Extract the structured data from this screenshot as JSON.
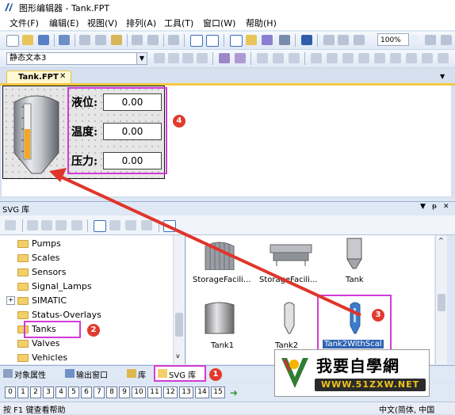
{
  "window": {
    "title": "图形编辑器 - Tank.FPT"
  },
  "menu": [
    "文件(F)",
    "编辑(E)",
    "视图(V)",
    "排列(A)",
    "工具(T)",
    "窗口(W)",
    "帮助(H)"
  ],
  "toolbar": {
    "zoom": "100%",
    "text_style": "静态文本3"
  },
  "document": {
    "tab_label": "Tank.FPT",
    "fields": [
      {
        "label": "液位:",
        "value": "0.00"
      },
      {
        "label": "温度:",
        "value": "0.00"
      },
      {
        "label": "压力:",
        "value": "0.00"
      }
    ]
  },
  "library": {
    "title": "SVG 库",
    "tree": [
      "Pumps",
      "Scales",
      "Sensors",
      "Signal_Lamps",
      "SIMATIC",
      "Status-Overlays",
      "Tanks",
      "Valves",
      "Vehicles"
    ],
    "selected_tree_item": "Tanks",
    "gallery": [
      {
        "caption": "StorageFacili..."
      },
      {
        "caption": "StorageFacili..."
      },
      {
        "caption": "Tank"
      },
      {
        "caption": "Tank1"
      },
      {
        "caption": "Tank2"
      },
      {
        "caption": "Tank2WithScal"
      }
    ]
  },
  "annotations": [
    "1",
    "2",
    "3",
    "4"
  ],
  "bottom_tabs": [
    "对象属性",
    "输出窗口",
    "库",
    "SVG 库"
  ],
  "layers": [
    "0",
    "1",
    "2",
    "3",
    "4",
    "5",
    "6",
    "7",
    "8",
    "9",
    "10",
    "11",
    "12",
    "13",
    "14",
    "15"
  ],
  "status": {
    "help": "按 F1 键查看帮助",
    "ime": "中文(简体, 中国"
  },
  "watermark": {
    "text": "我要自學網",
    "url": "WWW.51ZXW.NET"
  },
  "colors": {
    "highlight": "#d23bd6",
    "badge": "#e23a2e",
    "tab_accent": "#f4c842",
    "arrow": "#e0352b"
  }
}
